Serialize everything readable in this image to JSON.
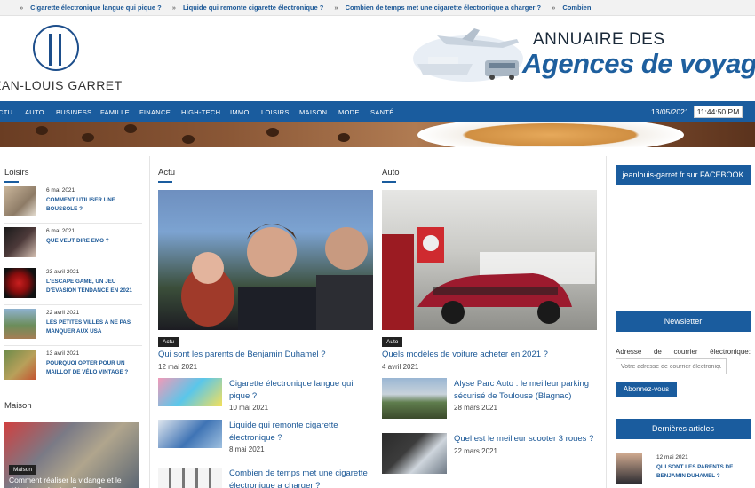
{
  "ticker": {
    "items": [
      "Cigarette électronique langue qui pique ?",
      "Liquide qui remonte cigarette électronique ?",
      "Combien de temps met une cigarette électronique a charger ?",
      "Combien"
    ]
  },
  "header": {
    "logo_text": "EAN-LOUIS GARRET",
    "banner_line1": "ANNUAIRE DES",
    "banner_line2": "Agences de voyage"
  },
  "nav": {
    "items": [
      "CTU",
      "AUTO",
      "BUSINESS",
      "FAMILLE",
      "FINANCE",
      "HIGH-TECH",
      "IMMO",
      "LOISIRS",
      "MAISON",
      "MODE",
      "SANTÉ"
    ],
    "date": "13/05/2021",
    "time": "11:44:50 PM"
  },
  "loisirs": {
    "title": "Loisirs",
    "items": [
      {
        "date": "6 mai 2021",
        "title": "COMMENT UTILISER UNE BOUSSOLE ?"
      },
      {
        "date": "6 mai 2021",
        "title": "QUE VEUT DIRE EMO ?"
      },
      {
        "date": "23 avril 2021",
        "title": "L'ESCAPE GAME, UN JEU D'ÉVASION TENDANCE EN 2021"
      },
      {
        "date": "22 avril 2021",
        "title": "LES PETITES VILLES À NE PAS MANQUER AUX USA"
      },
      {
        "date": "13 avril 2021",
        "title": "POURQUOI OPTER POUR UN MAILLOT DE VÉLO VINTAGE ?"
      }
    ]
  },
  "maison": {
    "title": "Maison",
    "tag": "Maison",
    "caption": "Comment réaliser la vidange et le détartrage du chauffe-eau ?"
  },
  "actu": {
    "title": "Actu",
    "tag": "Actu",
    "headline": "Qui sont les parents de Benjamin Duhamel ?",
    "date": "12 mai 2021",
    "items": [
      {
        "title": "Cigarette électronique langue qui pique ?",
        "date": "10 mai 2021"
      },
      {
        "title": "Liquide qui remonte cigarette électronique ?",
        "date": "8 mai 2021"
      },
      {
        "title": "Combien de temps met une cigarette électronique a charger ?",
        "date": ""
      }
    ]
  },
  "auto": {
    "title": "Auto",
    "tag": "Auto",
    "headline": "Quels modèles de voiture acheter en 2021 ?",
    "date": "4 avril 2021",
    "items": [
      {
        "title": "Alyse Parc Auto : le meilleur parking sécurisé de Toulouse (Blagnac)",
        "date": "28 mars 2021"
      },
      {
        "title": "Quel est le meilleur scooter 3 roues ?",
        "date": "22 mars 2021"
      }
    ]
  },
  "sidebar": {
    "facebook": "jeanlouis-garret.fr sur FACEBOOK",
    "newsletter_title": "Newsletter",
    "newsletter_label_words": [
      "Adresse",
      "de",
      "courrier",
      "électronique:"
    ],
    "newsletter_placeholder": "Votre adresse de courrier électronique",
    "newsletter_button": "Abonnez-vous",
    "recent_title": "Dernières articles",
    "recent_date": "12 mai 2021",
    "recent_headline": "QUI SONT LES PARENTS DE BENJAMIN DUHAMEL ?"
  },
  "colors": {
    "brand_blue": "#1a5c9e",
    "link_blue": "#1a5796"
  }
}
